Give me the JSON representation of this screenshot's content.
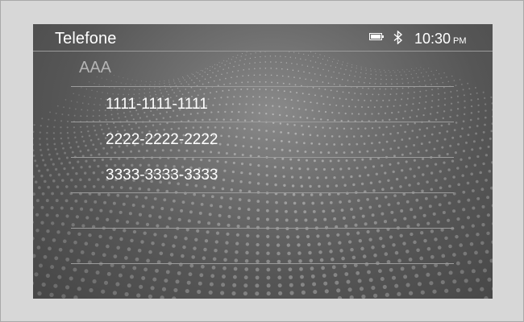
{
  "header": {
    "title": "Telefone",
    "time": "10:30",
    "ampm": "PM",
    "battery_icon": "battery-icon",
    "bluetooth_icon": "bluetooth-icon"
  },
  "contact": {
    "name": "AAA",
    "numbers": [
      {
        "number": "1111-1111-1111"
      },
      {
        "number": "2222-2222-2222"
      },
      {
        "number": "3333-3333-3333"
      }
    ]
  },
  "colors": {
    "text": "#ffffff",
    "contact_name": "#b4b4b4",
    "divider": "#9c9c9c",
    "frame": "#d7d7d7"
  }
}
